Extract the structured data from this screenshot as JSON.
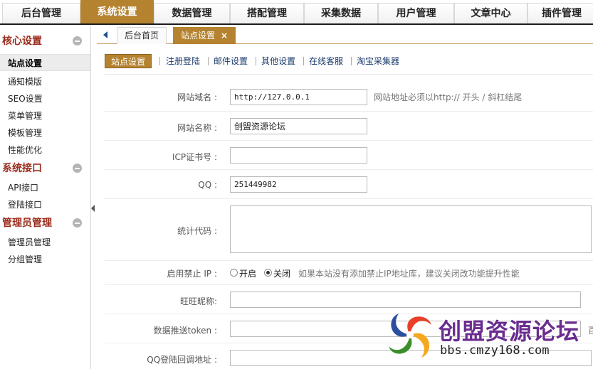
{
  "topnav": {
    "items": [
      "后台管理",
      "系统设置",
      "数据管理",
      "搭配管理",
      "采集数据",
      "用户管理",
      "文章中心",
      "插件管理"
    ],
    "active": "系统设置",
    "accent": "#b5832f"
  },
  "sidebar": {
    "groups": [
      {
        "title": "核心设置",
        "items": [
          "站点设置",
          "通知模版",
          "SEO设置",
          "菜单管理",
          "模板管理",
          "性能优化"
        ]
      },
      {
        "title": "系统接口",
        "items": [
          "API接口",
          "登陆接口"
        ]
      },
      {
        "title": "管理员管理",
        "items": [
          "管理员管理",
          "分组管理"
        ]
      }
    ],
    "active": "站点设置"
  },
  "tabs": {
    "home": "后台首页",
    "current": "站点设置",
    "close_glyph": "×"
  },
  "subtabs": [
    "站点设置",
    "注册登陆",
    "邮件设置",
    "其他设置",
    "在线客服",
    "淘宝采集器"
  ],
  "form": {
    "domain_label": "网站域名 :",
    "domain_value": "http://127.0.0.1",
    "domain_hint": "网站地址必须以http:// 开头 / 斜杠结尾",
    "name_label": "网站名称 :",
    "name_value": "创盟资源论坛",
    "icp_label": "ICP证书号 :",
    "icp_value": "",
    "qq_label": "QQ :",
    "qq_value": "251449982",
    "stats_label": "统计代码 :",
    "ipban_label": "启用禁止 IP :",
    "ipban_on": "开启",
    "ipban_off": "关闭",
    "ipban_hint": "如果本站没有添加禁止IP地址库，建议关闭改功能提升性能",
    "wangwang_label": "旺旺昵称:",
    "push_label": "数据推送token :",
    "push_hint_clipped": "百",
    "qqcallback_label": "QQ登陆回调地址 :"
  },
  "watermark": {
    "title": "创盟资源论坛",
    "url": "bbs.cmzy168.com"
  }
}
